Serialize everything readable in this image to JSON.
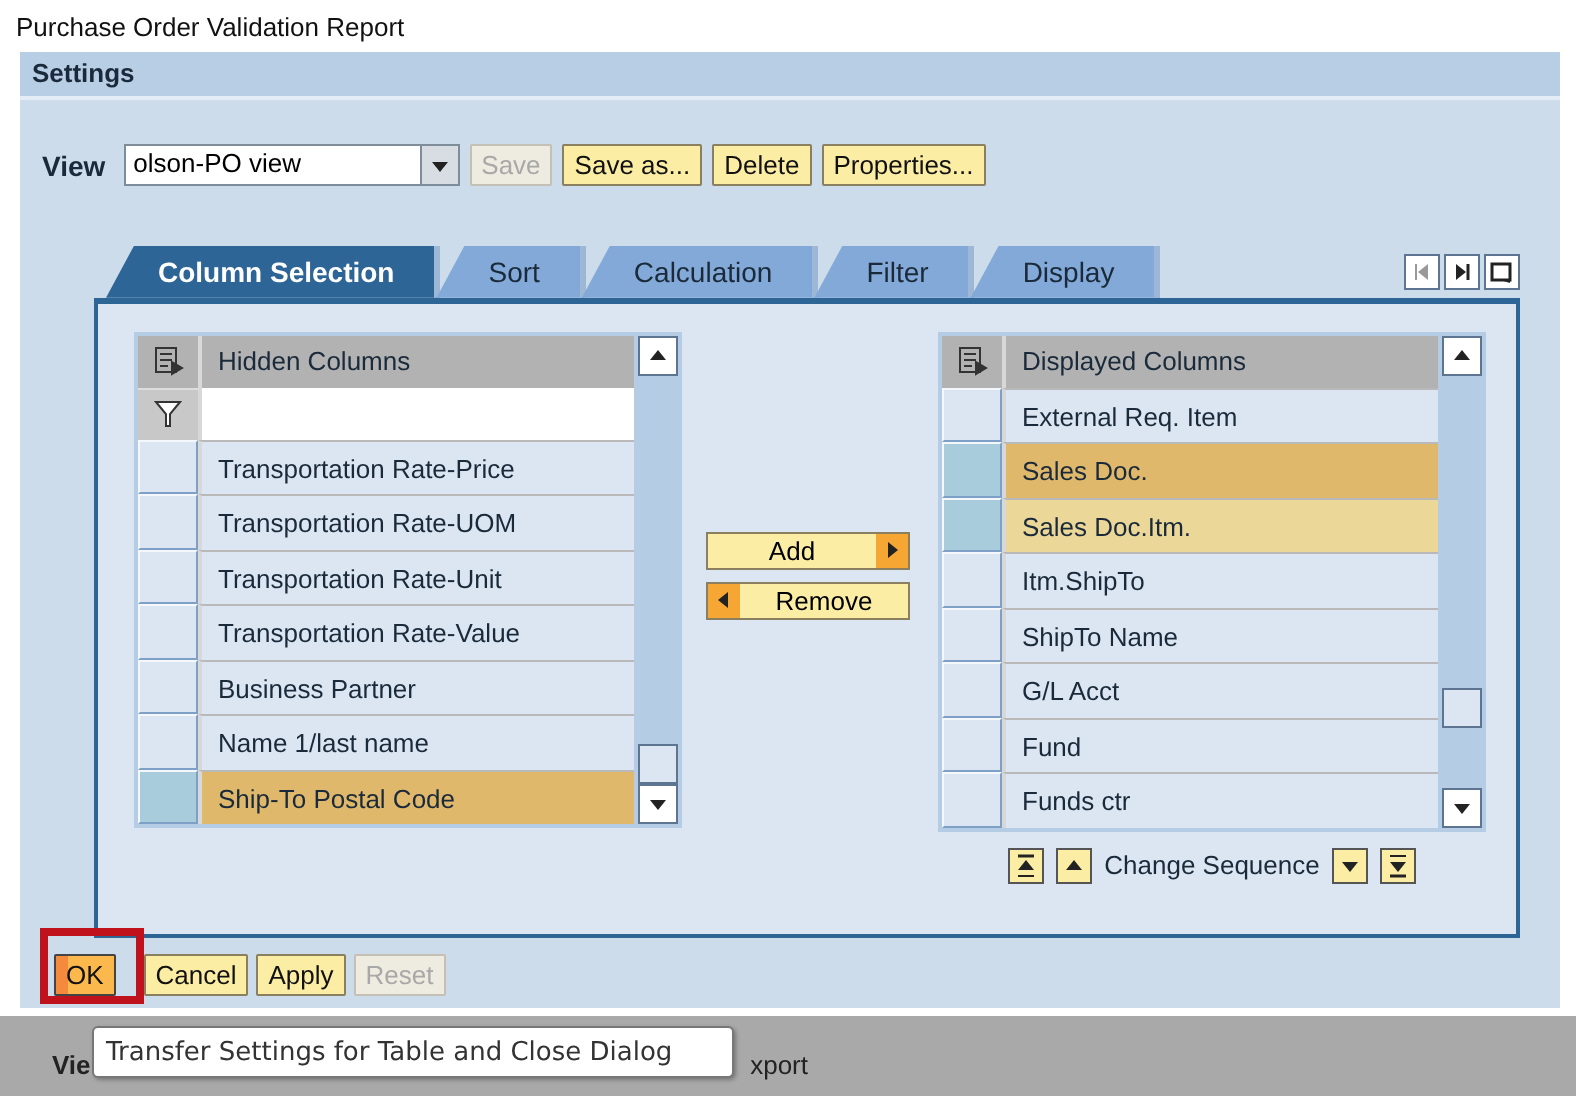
{
  "window": {
    "title": "Purchase Order Validation Report"
  },
  "panel": {
    "title": "Settings"
  },
  "view_row": {
    "label": "View",
    "value": "olson-PO view",
    "buttons": [
      {
        "label": "Save",
        "disabled": true
      },
      {
        "label": "Save as...",
        "disabled": false
      },
      {
        "label": "Delete",
        "disabled": false
      },
      {
        "label": "Properties...",
        "disabled": false
      }
    ]
  },
  "tabs": [
    {
      "label": "Column Selection",
      "selected": true
    },
    {
      "label": "Sort",
      "selected": false
    },
    {
      "label": "Calculation",
      "selected": false
    },
    {
      "label": "Filter",
      "selected": false
    },
    {
      "label": "Display",
      "selected": false
    }
  ],
  "hidden_columns": {
    "title": "Hidden Columns",
    "rows": [
      {
        "label": "Transportation Rate-Price",
        "selected": false,
        "lead": false
      },
      {
        "label": "Transportation Rate-UOM",
        "selected": false,
        "lead": false
      },
      {
        "label": "Transportation Rate-Unit",
        "selected": false,
        "lead": false
      },
      {
        "label": "Transportation Rate-Value",
        "selected": false,
        "lead": false
      },
      {
        "label": "Business Partner",
        "selected": false,
        "lead": false
      },
      {
        "label": "Name 1/last name",
        "selected": false,
        "lead": false
      },
      {
        "label": "Ship-To Postal Code",
        "selected": true,
        "lead": true
      }
    ]
  },
  "move_buttons": [
    {
      "label": "Add",
      "kind": "right"
    },
    {
      "label": "Remove",
      "kind": "left"
    }
  ],
  "displayed_columns": {
    "title": "Displayed Columns",
    "rows": [
      {
        "label": "External Req. Item",
        "selected": false,
        "lead": false
      },
      {
        "label": "Sales Doc.",
        "selected": true,
        "lead": true
      },
      {
        "label": "Sales Doc.Itm.",
        "selected": true,
        "lead": false
      },
      {
        "label": "Itm.ShipTo",
        "selected": false,
        "lead": false
      },
      {
        "label": "ShipTo Name",
        "selected": false,
        "lead": false
      },
      {
        "label": "G/L Acct",
        "selected": false,
        "lead": false
      },
      {
        "label": "Fund",
        "selected": false,
        "lead": false
      },
      {
        "label": "Funds ctr",
        "selected": false,
        "lead": false
      }
    ]
  },
  "sequence": {
    "label": "Change Sequence"
  },
  "footer_buttons": [
    {
      "label": "OK",
      "disabled": false,
      "focused": true
    },
    {
      "label": "Cancel",
      "disabled": false,
      "focused": false
    },
    {
      "label": "Apply",
      "disabled": false,
      "focused": false
    },
    {
      "label": "Reset",
      "disabled": true,
      "focused": false
    }
  ],
  "tooltip": {
    "text": "Transfer Settings for Table and Close Dialog"
  },
  "bottom_bar": {
    "left": "Vie",
    "right": "xport"
  }
}
